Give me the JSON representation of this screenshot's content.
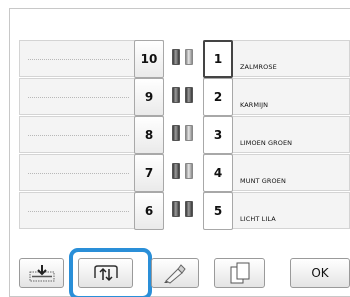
{
  "rows": [
    {
      "left_number": "10",
      "right_number": "1",
      "color_name": "ZALMROSE",
      "spools": [
        "dark",
        "light"
      ]
    },
    {
      "left_number": "9",
      "right_number": "2",
      "color_name": "KARMIJN",
      "spools": [
        "dark",
        "dark"
      ]
    },
    {
      "left_number": "8",
      "right_number": "3",
      "color_name": "LIMOEN GROEN",
      "spools": [
        "dark",
        "light"
      ]
    },
    {
      "left_number": "7",
      "right_number": "4",
      "color_name": "MUNT GROEN",
      "spools": [
        "dark",
        "light"
      ]
    },
    {
      "left_number": "6",
      "right_number": "5",
      "color_name": "LICHT LILA",
      "spools": [
        "dark",
        "dark"
      ]
    }
  ],
  "toolbar": {
    "move_icon": "move-to-bottom-icon",
    "sort_icon": "color-sort-icon",
    "color_icon": "color-pen-icon",
    "page_icon": "page-copy-icon",
    "ok_label": "OK"
  },
  "colors": {
    "highlight": "#2a8fd8"
  }
}
